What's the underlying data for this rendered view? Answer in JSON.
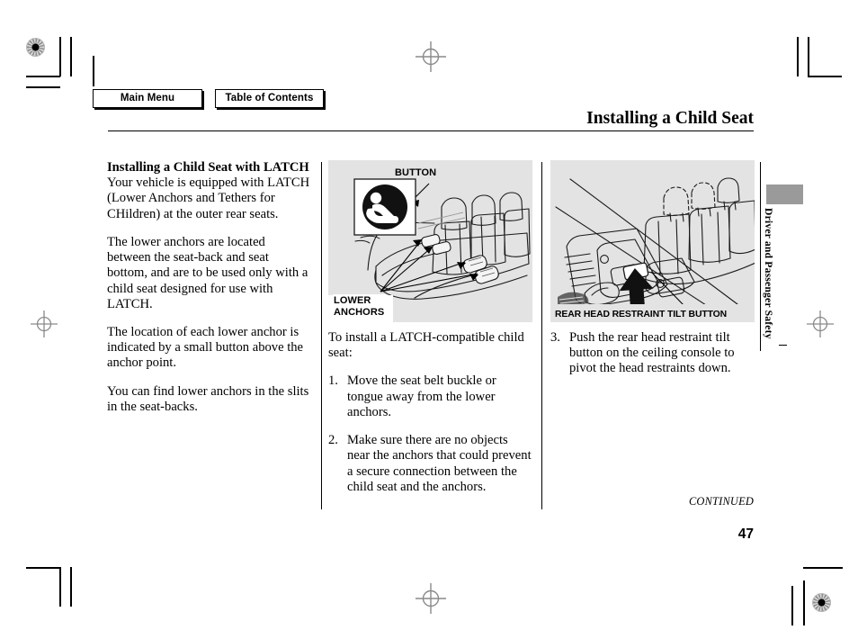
{
  "nav": {
    "main_menu": "Main Menu",
    "table_of_contents": "Table of Contents"
  },
  "header": {
    "title": "Installing a Child Seat"
  },
  "left_column": {
    "heading": "Installing a Child Seat with LATCH",
    "paragraph_1": "Your vehicle is equipped with LATCH (Lower Anchors and Tethers for CHildren) at the outer rear seats.",
    "paragraph_2": "The lower anchors are located between the seat-back and seat bottom, and are to be used only with a child seat designed for use with LATCH.",
    "paragraph_3": "The location of each lower anchor is indicated by a small button above the anchor point.",
    "paragraph_4": "You can find lower anchors in the slits in the seat-backs."
  },
  "middle_column": {
    "figure": {
      "label_button": "BUTTON",
      "label_lower_anchors_line1": "LOWER",
      "label_lower_anchors_line2": "ANCHORS",
      "icon": "child-seat-icon",
      "alt": "Rear seat showing lower anchor locations and button markers"
    },
    "intro": "To install a LATCH-compatible child seat:",
    "steps": [
      {
        "number": "1.",
        "text": "Move the seat belt buckle or tongue away from the lower anchors."
      },
      {
        "number": "2.",
        "text": "Make sure there are no objects near the anchors that could prevent a secure connection between the child seat and the anchors."
      }
    ]
  },
  "right_column": {
    "figure": {
      "caption": "REAR HEAD RESTRAINT TILT BUTTON",
      "alt": "Ceiling console with rear head restraint tilt button and rear seat head restraints"
    },
    "steps": [
      {
        "number": "3.",
        "text": "Push the rear head restraint tilt button on the ceiling console to pivot the head restraints down."
      }
    ]
  },
  "side_tab": {
    "label": "Driver and Passenger Safety"
  },
  "footer": {
    "continued": "CONTINUED",
    "page_number": "47"
  },
  "colors": {
    "panel_background": "#e3e3e3",
    "tab_block": "#9a9a9a",
    "text": "#000000",
    "page_background": "#ffffff"
  }
}
